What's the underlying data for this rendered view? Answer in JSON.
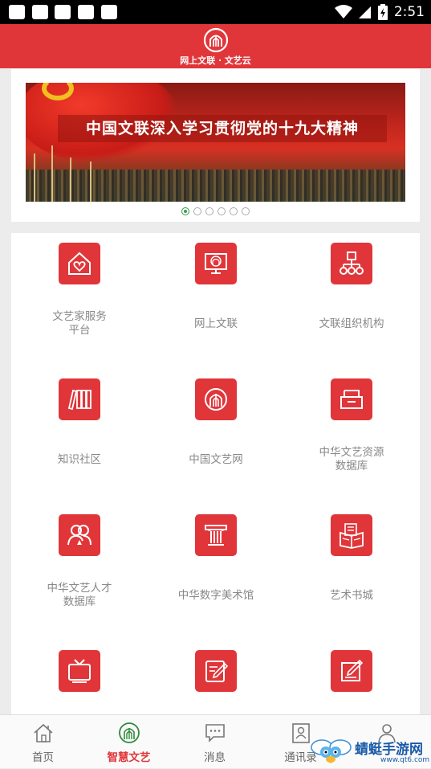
{
  "status_bar": {
    "time": "2:51"
  },
  "header": {
    "title": "网上文联 · 文艺云",
    "logo_icon": "wenlian-logo-icon",
    "color": "#e0363a"
  },
  "banner": {
    "text": "中国文联深入学习贯彻党的十九大精神",
    "slide_count": 6,
    "active_slide": 1
  },
  "grid": {
    "items": [
      {
        "label": "文艺家服务\n平台",
        "icon": "heart-house-icon"
      },
      {
        "label": "网上文联",
        "icon": "monitor-logo-icon"
      },
      {
        "label": "文联组织机构",
        "icon": "org-chart-icon"
      },
      {
        "label": "知识社区",
        "icon": "books-icon"
      },
      {
        "label": "中国文艺网",
        "icon": "wenyi-logo-icon"
      },
      {
        "label": "中华文艺资源\n数据库",
        "icon": "storage-box-icon"
      },
      {
        "label": "中华文艺人才\n数据库",
        "icon": "people-icon"
      },
      {
        "label": "中华数字美术馆",
        "icon": "museum-column-icon"
      },
      {
        "label": "艺术书城",
        "icon": "open-book-icon"
      },
      {
        "label": "",
        "icon": "tv-icon"
      },
      {
        "label": "",
        "icon": "notepad-pen-icon"
      },
      {
        "label": "",
        "icon": "edit-doc-icon"
      }
    ]
  },
  "tabbar": {
    "tabs": [
      {
        "label": "首页",
        "icon": "home-icon"
      },
      {
        "label": "智慧文艺",
        "icon": "wenyi-logo-icon",
        "active": true
      },
      {
        "label": "消息",
        "icon": "chat-bubble-icon"
      },
      {
        "label": "通讯录",
        "icon": "contacts-card-icon"
      },
      {
        "label": "",
        "icon": "user-icon"
      }
    ]
  },
  "watermark": {
    "title": "蜻蜓手游网",
    "url": "www.qt6.com"
  }
}
